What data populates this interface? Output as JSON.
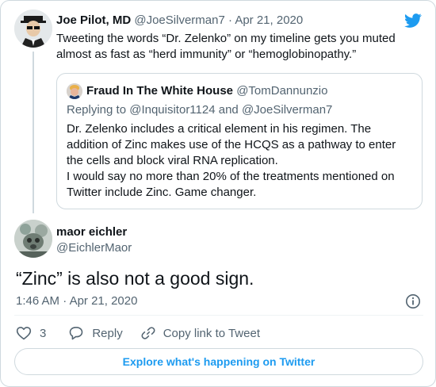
{
  "parent_tweet": {
    "author_name": "Joe Pilot, MD",
    "author_handle": "@JoeSilverman7",
    "separator": "·",
    "date": "Apr 21, 2020",
    "text": "Tweeting the words “Dr. Zelenko” on my timeline gets you muted almost as fast as “herd immunity” or “hemoglobinopathy.”"
  },
  "quoted_tweet": {
    "author_name": "Fraud In The White House",
    "author_handle": "@TomDannunzio",
    "replying_prefix": "Replying to",
    "replying_to_1": "@Inquisitor1124",
    "replying_and": "and",
    "replying_to_2": "@JoeSilverman7",
    "paragraph_1": "Dr. Zelenko includes a critical element in his regimen. The addition of Zinc makes use of the HCQS as a pathway to enter the cells and block viral RNA replication.",
    "paragraph_2": "I would say no more than 20% of the treatments mentioned on Twitter include Zinc.  Game changer."
  },
  "main_tweet": {
    "author_name": "maor eichler",
    "author_handle": "@EichlerMaor",
    "text": "“Zinc” is also not a good sign.",
    "time": "1:46 AM",
    "separator": "·",
    "date": "Apr 21, 2020"
  },
  "actions": {
    "like_count": "3",
    "reply_label": "Reply",
    "copy_link_label": "Copy link to Tweet"
  },
  "explore_button": {
    "label": "Explore what's happening on Twitter"
  },
  "icons": {
    "brand": "twitter-bird-icon",
    "like": "heart-icon",
    "reply": "speech-bubble-icon",
    "copy": "link-icon",
    "info": "info-icon"
  },
  "colors": {
    "accent": "#1d9bf0",
    "text_primary": "#0f1419",
    "text_secondary": "#536471",
    "border": "#cfd9de"
  }
}
